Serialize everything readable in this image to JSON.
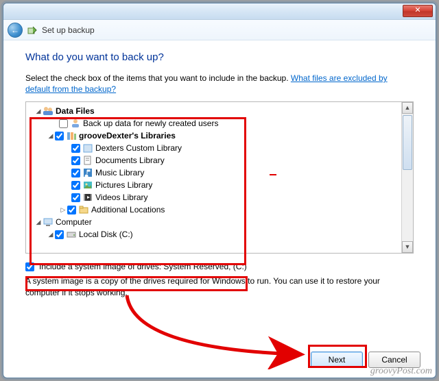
{
  "window": {
    "close_glyph": "✕",
    "back_glyph": "←",
    "title": "Set up backup"
  },
  "heading": "What do you want to back up?",
  "instruction_prefix": "Select the check box of the items that you want to include in the backup. ",
  "help_link": "What files are excluded by default from the backup?",
  "tree": {
    "data_files": "Data Files",
    "backup_new_users": "Back up data for newly created users",
    "libraries": "grooveDexter's Libraries",
    "lib_custom": "Dexters Custom Library",
    "lib_documents": "Documents Library",
    "lib_music": "Music Library",
    "lib_pictures": "Pictures Library",
    "lib_videos": "Videos Library",
    "lib_additional": "Additional Locations",
    "computer": "Computer",
    "local_disk": "Local Disk (C:)"
  },
  "system_image": {
    "label": "Include a system image of drives: System Reserved, (C:)",
    "description": "A system image is a copy of the drives required for Windows to run. You can use it to restore your computer if it stops working."
  },
  "buttons": {
    "next": "Next",
    "cancel": "Cancel"
  },
  "watermark": "groovyPost.com"
}
